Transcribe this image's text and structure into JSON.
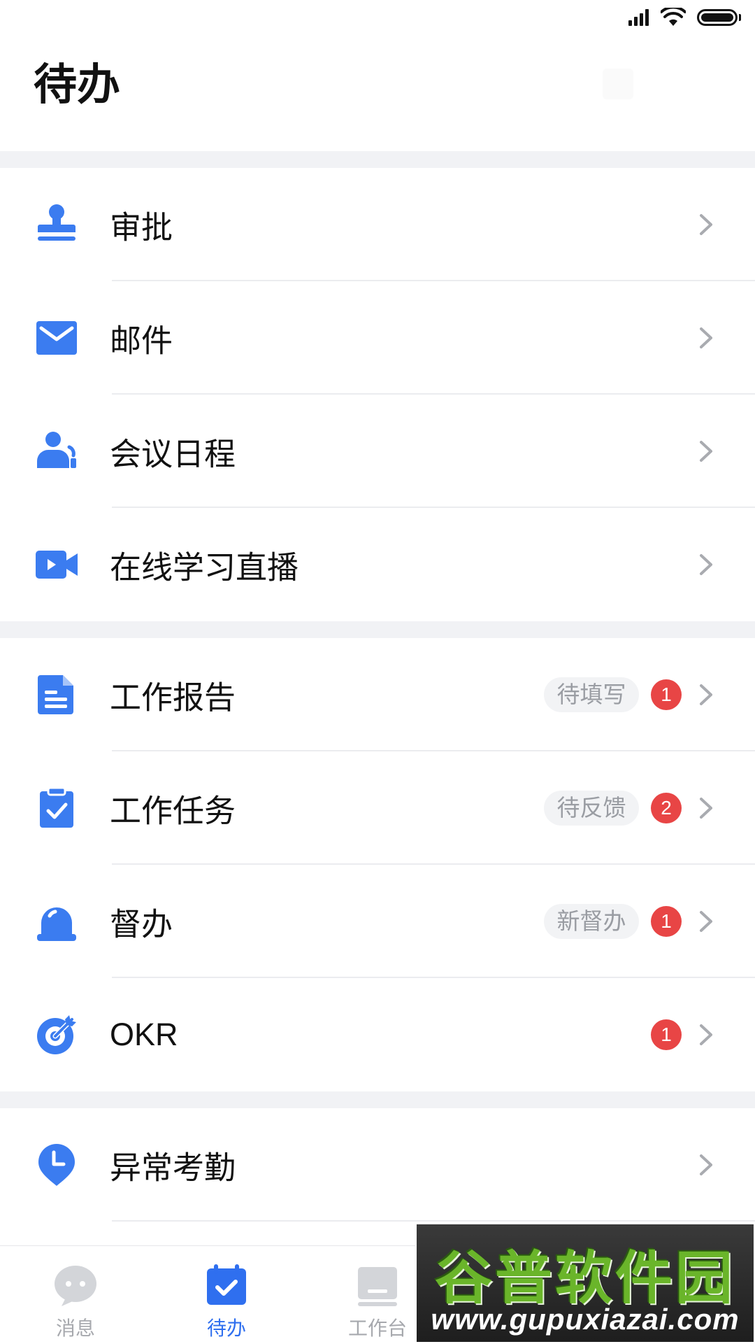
{
  "header": {
    "title": "待办"
  },
  "colors": {
    "accent": "#2f6fef",
    "icon_blue": "#3b7cf0",
    "badge_red": "#e84545",
    "tag_bg": "#f2f3f5",
    "tag_text": "#9a9da3",
    "section_gap": "#f1f2f5"
  },
  "sections": [
    {
      "items": [
        {
          "label": "审批",
          "icon": "stamp-icon"
        },
        {
          "label": "邮件",
          "icon": "mail-icon"
        },
        {
          "label": "会议日程",
          "icon": "meeting-icon"
        },
        {
          "label": "在线学习直播",
          "icon": "video-camera-icon"
        }
      ]
    },
    {
      "items": [
        {
          "label": "工作报告",
          "icon": "document-icon",
          "tag": "待填写",
          "badge": "1"
        },
        {
          "label": "工作任务",
          "icon": "clipboard-check-icon",
          "tag": "待反馈",
          "badge": "2"
        },
        {
          "label": "督办",
          "icon": "alarm-bell-icon",
          "tag": "新督办",
          "badge": "1"
        },
        {
          "label": "OKR",
          "icon": "target-icon",
          "badge": "1"
        }
      ]
    },
    {
      "items": [
        {
          "label": "异常考勤",
          "icon": "clock-pin-icon"
        }
      ]
    }
  ],
  "tabbar": {
    "tabs": [
      {
        "label": "消息",
        "icon": "chat-bubble-icon",
        "active": false
      },
      {
        "label": "待办",
        "icon": "calendar-check-icon",
        "active": true
      },
      {
        "label": "工作台",
        "icon": "workbench-icon",
        "active": false
      }
    ]
  },
  "watermark": {
    "title": "谷普软件园",
    "url": "www.gupuxiazai.com"
  }
}
